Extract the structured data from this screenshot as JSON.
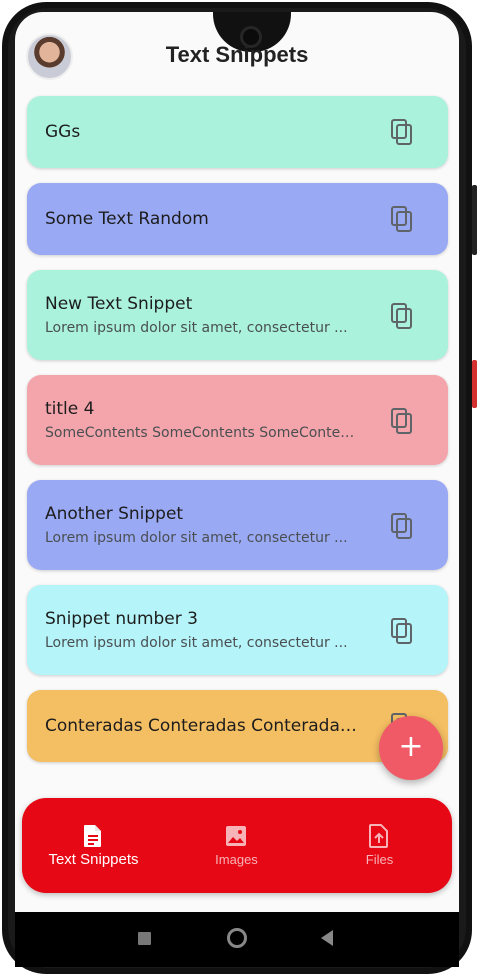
{
  "header": {
    "title": "Text Snippets"
  },
  "snippets": [
    {
      "title": "GGs",
      "subtitle": "",
      "color": "#aaf2dc"
    },
    {
      "title": "Some Text Random",
      "subtitle": "",
      "color": "#9aa9f3"
    },
    {
      "title": "New Text Snippet",
      "subtitle": "Lorem ipsum dolor sit amet, consectetur ...",
      "color": "#aaf2dc"
    },
    {
      "title": "title 4",
      "subtitle": "SomeContents SomeContents SomeContent...",
      "color": "#f4a5ab"
    },
    {
      "title": "Another Snippet",
      "subtitle": "Lorem ipsum dolor sit amet, consectetur ...",
      "color": "#9aa9f3"
    },
    {
      "title": "Snippet number 3",
      "subtitle": "Lorem ipsum dolor sit amet, consectetur ...",
      "color": "#b5f4f8"
    },
    {
      "title": "Conteradas Conteradas Conteradas ...",
      "subtitle": "",
      "color": "#f4be62"
    }
  ],
  "fab": {
    "label": "+"
  },
  "bottom_nav": {
    "items": [
      {
        "label": "Text Snippets",
        "icon": "document-icon",
        "active": true
      },
      {
        "label": "Images",
        "icon": "image-icon",
        "active": false
      },
      {
        "label": "Files",
        "icon": "file-upload-icon",
        "active": false
      }
    ]
  },
  "colors": {
    "accent": "#e60815",
    "fab": "#f05a66",
    "background": "#fafafa"
  }
}
